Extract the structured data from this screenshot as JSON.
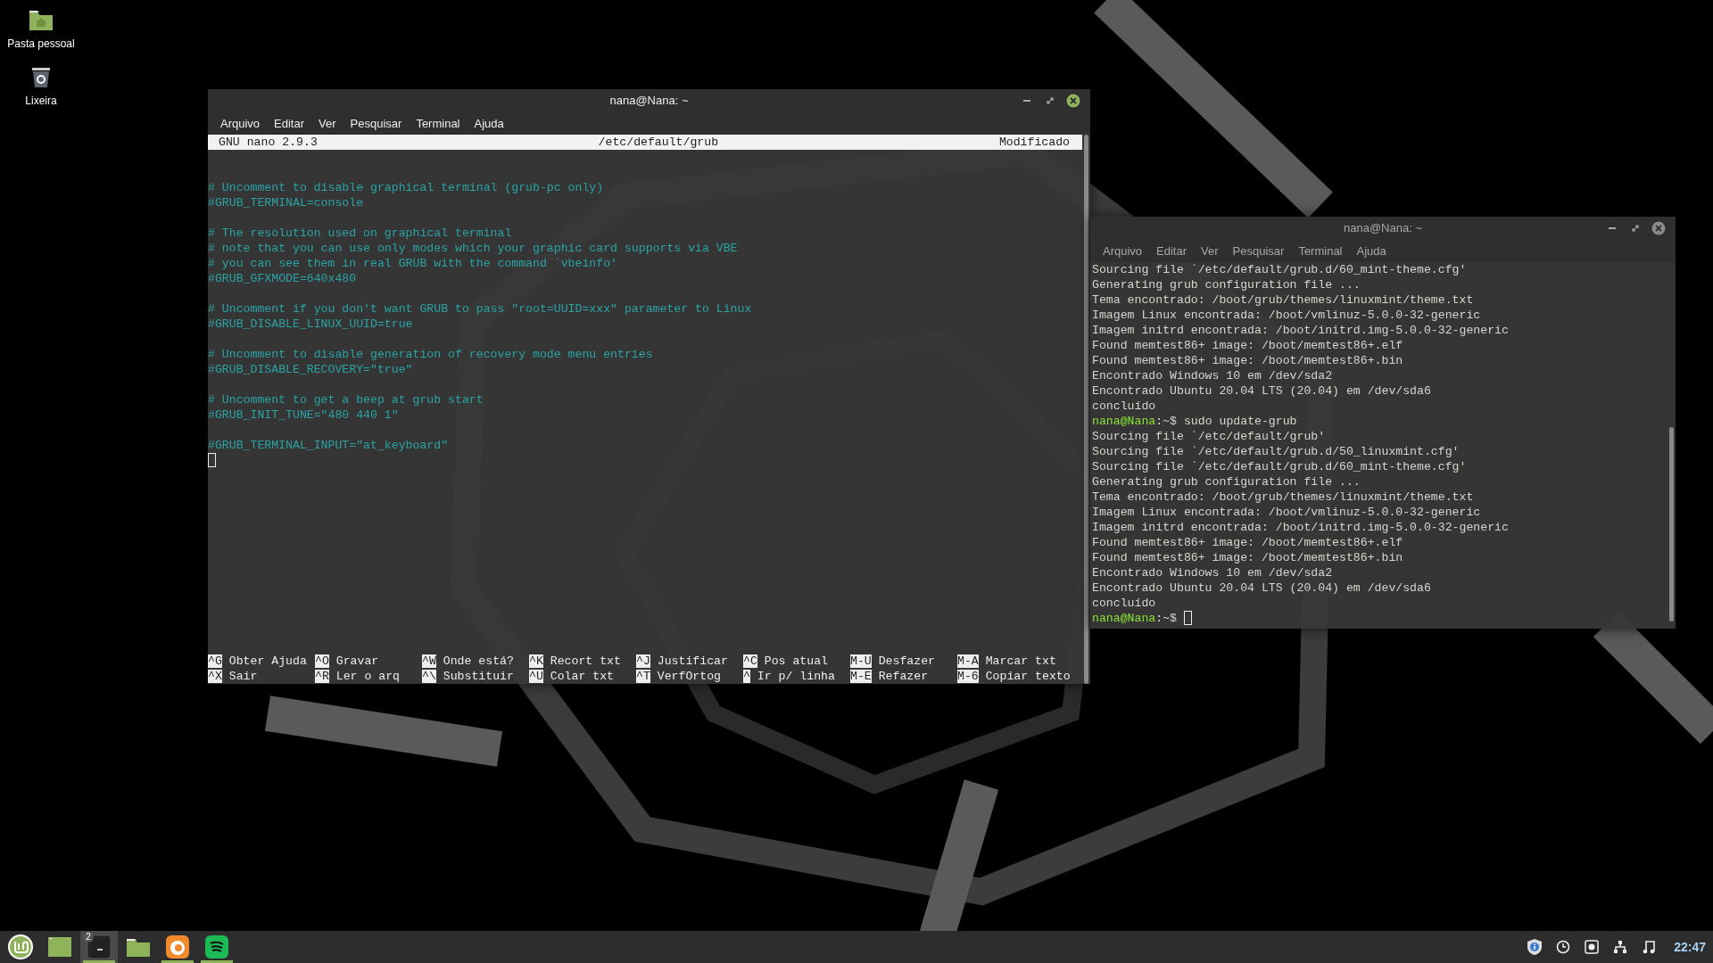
{
  "desktop_icons": [
    {
      "kind": "home-folder",
      "label": "Pasta pessoal"
    },
    {
      "kind": "trash",
      "label": "Lixeira"
    }
  ],
  "windows": [
    {
      "kind": "nano",
      "title": "nana@Nana: ~",
      "active": true,
      "menu": [
        "Arquivo",
        "Editar",
        "Ver",
        "Pesquisar",
        "Terminal",
        "Ajuda"
      ],
      "header": {
        "version": "GNU nano 2.9.3",
        "file": "/etc/default/grub",
        "status": "Modificado"
      },
      "blocks": [
        [
          "# Uncomment to disable graphical terminal (grub-pc only)",
          "#GRUB_TERMINAL=console"
        ],
        [
          "# The resolution used on graphical terminal",
          "# note that you can use only modes which your graphic card supports via VBE",
          "# you can see them in real GRUB with the command `vbeinfo'",
          "#GRUB_GFXMODE=640x480"
        ],
        [
          "# Uncomment if you don't want GRUB to pass \"root=UUID=xxx\" parameter to Linux",
          "#GRUB_DISABLE_LINUX_UUID=true"
        ],
        [
          "# Uncomment to disable generation of recovery mode menu entries",
          "#GRUB_DISABLE_RECOVERY=\"true\""
        ],
        [
          "# Uncomment to get a beep at grub start",
          "#GRUB_INIT_TUNE=\"480 440 1\""
        ],
        [
          "#GRUB_TERMINAL_INPUT=\"at_keyboard\""
        ]
      ],
      "shortcuts": [
        [
          {
            "key": "^G",
            "label": "Obter Ajuda"
          },
          {
            "key": "^X",
            "label": "Sair"
          }
        ],
        [
          {
            "key": "^O",
            "label": "Gravar"
          },
          {
            "key": "^R",
            "label": "Ler o arq"
          }
        ],
        [
          {
            "key": "^W",
            "label": "Onde está?"
          },
          {
            "key": "^\\",
            "label": "Substituir"
          }
        ],
        [
          {
            "key": "^K",
            "label": "Recort txt"
          },
          {
            "key": "^U",
            "label": "Colar txt"
          }
        ],
        [
          {
            "key": "^J",
            "label": "Justificar"
          },
          {
            "key": "^T",
            "label": "VerfOrtog"
          }
        ],
        [
          {
            "key": "^C",
            "label": "Pos atual"
          },
          {
            "key": "^",
            "label": "Ir p/ linha"
          }
        ],
        [
          {
            "key": "M-U",
            "label": "Desfazer"
          },
          {
            "key": "M-E",
            "label": "Refazer"
          }
        ],
        [
          {
            "key": "M-A",
            "label": "Marcar txt"
          },
          {
            "key": "M-6",
            "label": "Copiar texto"
          }
        ]
      ]
    },
    {
      "kind": "console",
      "title": "nana@Nana: ~",
      "active": false,
      "menu": [
        "Arquivo",
        "Editar",
        "Ver",
        "Pesquisar",
        "Terminal",
        "Ajuda"
      ],
      "lines": [
        {
          "kind": "output",
          "text": "Sourcing file `/etc/default/grub.d/60_mint-theme.cfg'"
        },
        {
          "kind": "output",
          "text": "Generating grub configuration file ..."
        },
        {
          "kind": "output",
          "text": "Tema encontrado: /boot/grub/themes/linuxmint/theme.txt"
        },
        {
          "kind": "output",
          "text": "Imagem Linux encontrada: /boot/vmlinuz-5.0.0-32-generic"
        },
        {
          "kind": "output",
          "text": "Imagem initrd encontrada: /boot/initrd.img-5.0.0-32-generic"
        },
        {
          "kind": "output",
          "text": "Found memtest86+ image: /boot/memtest86+.elf"
        },
        {
          "kind": "output",
          "text": "Found memtest86+ image: /boot/memtest86+.bin"
        },
        {
          "kind": "output",
          "text": "Encontrado Windows 10 em /dev/sda2"
        },
        {
          "kind": "output",
          "text": "Encontrado Ubuntu 20.04 LTS (20.04) em /dev/sda6"
        },
        {
          "kind": "output",
          "text": "concluído"
        },
        {
          "kind": "prompt",
          "user": "nana@Nana",
          "path": ":~$",
          "command": "sudo update-grub"
        },
        {
          "kind": "output",
          "text": "Sourcing file `/etc/default/grub'"
        },
        {
          "kind": "output",
          "text": "Sourcing file `/etc/default/grub.d/50_linuxmint.cfg'"
        },
        {
          "kind": "output",
          "text": "Sourcing file `/etc/default/grub.d/60_mint-theme.cfg'"
        },
        {
          "kind": "output",
          "text": "Generating grub configuration file ..."
        },
        {
          "kind": "output",
          "text": "Tema encontrado: /boot/grub/themes/linuxmint/theme.txt"
        },
        {
          "kind": "output",
          "text": "Imagem Linux encontrada: /boot/vmlinuz-5.0.0-32-generic"
        },
        {
          "kind": "output",
          "text": "Imagem initrd encontrada: /boot/initrd.img-5.0.0-32-generic"
        },
        {
          "kind": "output",
          "text": "Found memtest86+ image: /boot/memtest86+.elf"
        },
        {
          "kind": "output",
          "text": "Found memtest86+ image: /boot/memtest86+.bin"
        },
        {
          "kind": "output",
          "text": "Encontrado Windows 10 em /dev/sda2"
        },
        {
          "kind": "output",
          "text": "Encontrado Ubuntu 20.04 LTS (20.04) em /dev/sda6"
        },
        {
          "kind": "output",
          "text": "concluído"
        },
        {
          "kind": "prompt",
          "user": "nana@Nana",
          "path": ":~$",
          "cursor": true
        }
      ]
    }
  ],
  "taskbar": {
    "launchers": [
      {
        "kind": "menu",
        "running": false,
        "selected": false
      },
      {
        "kind": "desktop",
        "running": false,
        "selected": false
      },
      {
        "kind": "terminal",
        "running": true,
        "selected": true,
        "badge": "2"
      },
      {
        "kind": "files",
        "running": false,
        "selected": false
      },
      {
        "kind": "browser",
        "running": true,
        "selected": false
      },
      {
        "kind": "music",
        "running": true,
        "selected": false
      }
    ],
    "tray": [
      {
        "kind": "shield"
      },
      {
        "kind": "clock"
      },
      {
        "kind": "drive"
      },
      {
        "kind": "network"
      },
      {
        "kind": "sound"
      }
    ],
    "clock": "22:47"
  }
}
